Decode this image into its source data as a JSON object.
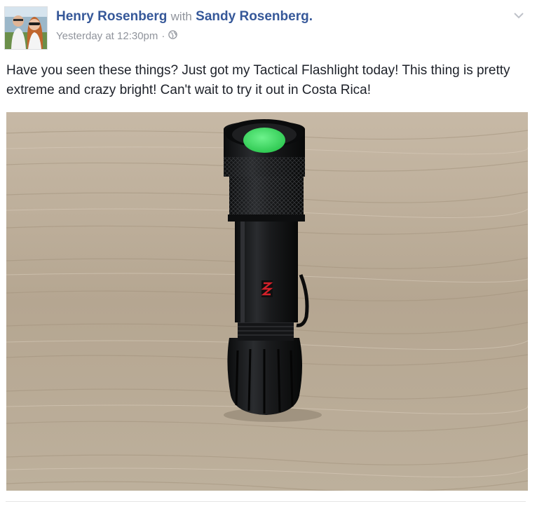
{
  "post": {
    "author": "Henry Rosenberg",
    "with_word": "with",
    "tagged": "Sandy Rosenberg.",
    "timestamp": "Yesterday at 12:30pm",
    "separator": "·",
    "privacy_icon": "globe-icon",
    "menu_icon": "chevron-down-icon",
    "text": "Have you seen these things? Just got my Tactical Flashlight today! This thing is pretty extreme and crazy bright! Can't wait to try it out in Costa Rica!"
  },
  "photo": {
    "subject": "flashlight",
    "lens_color": "#3fe36a",
    "body_color": "#151618",
    "table_color": "#b9ab98",
    "logo_color": "#d4212a"
  },
  "colors": {
    "link": "#365899",
    "meta": "#90949c",
    "text": "#1d2129"
  }
}
